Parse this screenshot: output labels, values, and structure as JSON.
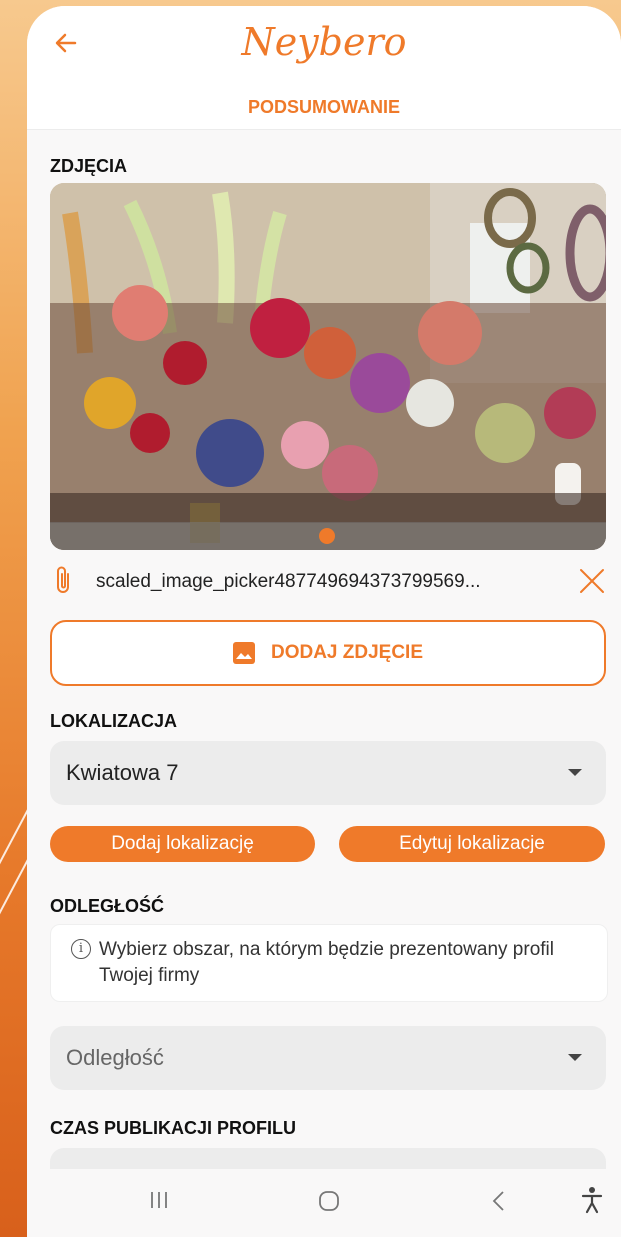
{
  "header": {
    "brand": "Neybero",
    "subtitle": "PODSUMOWANIE"
  },
  "photos": {
    "section_label": "ZDJĘCIA",
    "file_name": "scaled_image_picker487749694373799569...",
    "add_button_label": "DODAJ ZDJĘCIE",
    "carousel_index": 1,
    "carousel_count": 1
  },
  "location": {
    "section_label": "LOKALIZACJA",
    "selected_value": "Kwiatowa 7",
    "add_button_label": "Dodaj lokalizację",
    "edit_button_label": "Edytuj lokalizacje"
  },
  "distance": {
    "section_label": "ODLEGŁOŚĆ",
    "info_text": "Wybierz obszar, na którym będzie prezentowany profil Twojej firmy",
    "placeholder": "Odległość"
  },
  "publication": {
    "section_label": "CZAS PUBLIKACJI PROFILU"
  },
  "icons": {
    "back": "arrow-left-icon",
    "attachment": "paperclip-icon",
    "remove": "close-icon",
    "add_photo": "image-icon",
    "info": "info-icon",
    "dropdown": "caret-down-icon",
    "nav_recents": "recents-icon",
    "nav_home": "home-icon",
    "nav_back": "chevron-left-icon",
    "nav_accessibility": "accessibility-icon"
  },
  "colors": {
    "accent": "#ef7a2a"
  }
}
